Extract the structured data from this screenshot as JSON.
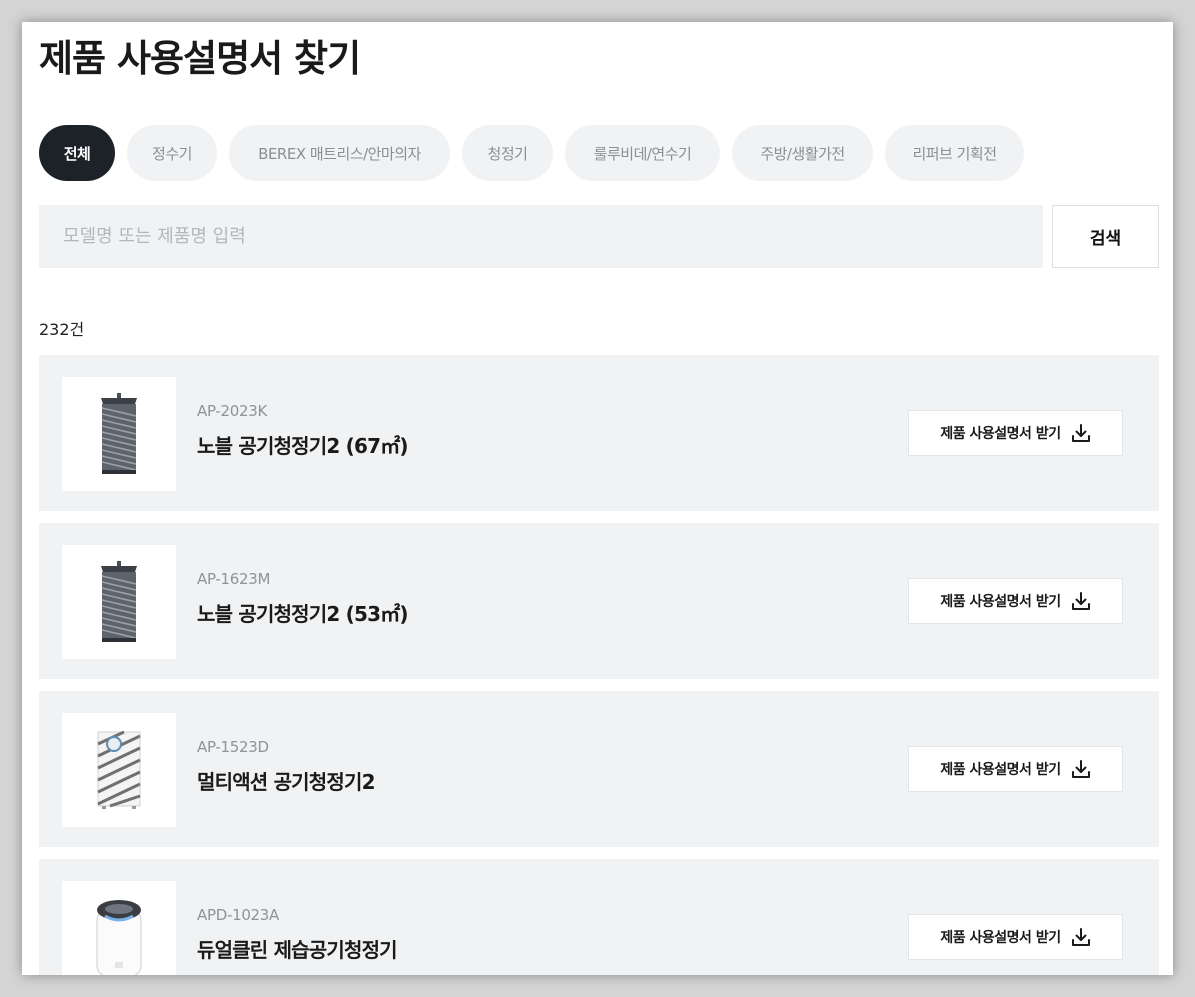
{
  "header": {
    "title": "제품 사용설명서 찾기"
  },
  "tabs": [
    {
      "label": "전체",
      "active": true
    },
    {
      "label": "정수기",
      "active": false
    },
    {
      "label": "BEREX 매트리스/안마의자",
      "active": false
    },
    {
      "label": "청정기",
      "active": false
    },
    {
      "label": "룰루비데/연수기",
      "active": false
    },
    {
      "label": "주방/생활가전",
      "active": false
    },
    {
      "label": "리퍼브 기획전",
      "active": false
    }
  ],
  "search": {
    "placeholder": "모델명 또는 제품명 입력",
    "value": "",
    "button_label": "검색"
  },
  "results": {
    "count_label": "232건"
  },
  "products": [
    {
      "model": "AP-2023K",
      "name": "노블 공기청정기2 (67㎡)",
      "image_icon": "air-purifier-tower-icon",
      "button_label": "제품 사용설명서 받기"
    },
    {
      "model": "AP-1623M",
      "name": "노블 공기청정기2 (53㎡)",
      "image_icon": "air-purifier-tower-icon",
      "button_label": "제품 사용설명서 받기"
    },
    {
      "model": "AP-1523D",
      "name": "멀티액션 공기청정기2",
      "image_icon": "air-purifier-striped-icon",
      "button_label": "제품 사용설명서 받기"
    },
    {
      "model": "APD-1023A",
      "name": "듀얼클린 제습공기청정기",
      "image_icon": "dehumidifier-icon",
      "button_label": "제품 사용설명서 받기"
    }
  ],
  "colors": {
    "active_tab_bg": "#1c2227",
    "tab_bg": "#f1f2f4",
    "card_bg": "#f1f2f4",
    "muted_text": "#8d939a"
  }
}
